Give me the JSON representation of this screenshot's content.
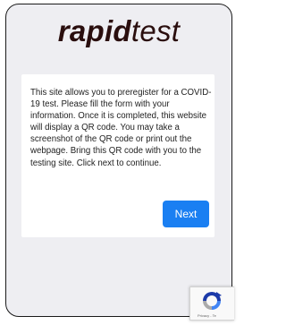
{
  "logo": {
    "bold": "rapid",
    "light": "test",
    "color": "#2a0e0e"
  },
  "card": {
    "instructions": "This site allows you to preregister for a COVID-19 test. Please fill the form with your information. Once it is completed, this website will display a QR code. You may take a screenshot of the QR code or print out the webpage. Bring this QR code with you to the testing site. Click next to continue.",
    "next_label": "Next",
    "next_color": "#1a7ff2"
  },
  "recaptcha": {
    "icon": "recaptcha-icon",
    "label": "Privacy - Te"
  },
  "colors": {
    "page_background": "#eeeef2",
    "card_background": "#ffffff"
  }
}
